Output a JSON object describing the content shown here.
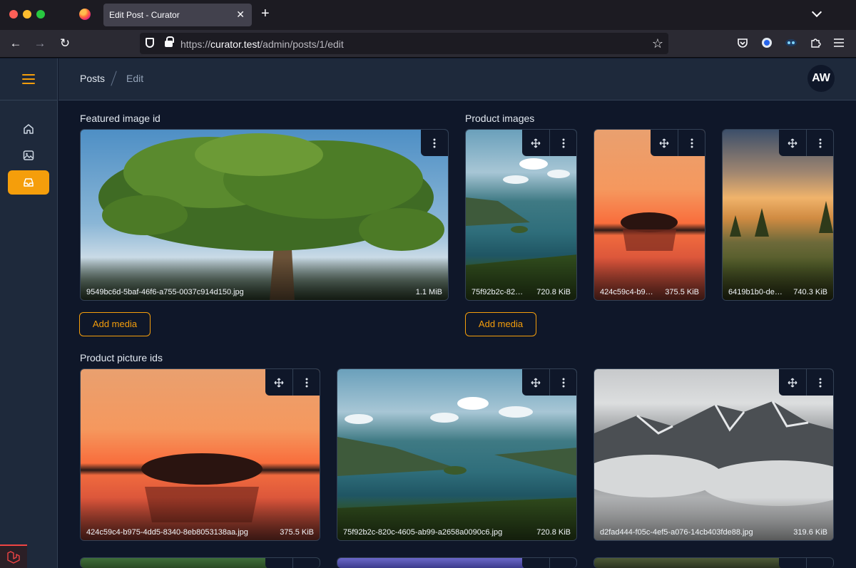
{
  "browser": {
    "tab_title": "Edit Post - Curator",
    "url_prefix": "https://",
    "url_host": "curator.test",
    "url_path": "/admin/posts/1/edit"
  },
  "breadcrumb": {
    "posts": "Posts",
    "edit": "Edit"
  },
  "user": {
    "initials": "AW"
  },
  "colors": {
    "accent": "#f59e0b",
    "background": "#0f1729",
    "panel": "#1e293b"
  },
  "featured": {
    "label": "Featured image id",
    "image": {
      "name": "9549bc6d-5baf-46f6-a755-0037c914d150.jpg",
      "size": "1.1 MiB",
      "scene": "tree"
    },
    "add_label": "Add media"
  },
  "product_images": {
    "label": "Product images",
    "items": [
      {
        "name": "75f92b2c-82…",
        "size": "720.8 KiB",
        "scene": "lake"
      },
      {
        "name": "424c59c4-b9…",
        "size": "375.5 KiB",
        "scene": "sunset"
      },
      {
        "name": "6419b1b0-de…",
        "size": "740.3 KiB",
        "scene": "field"
      }
    ],
    "add_label": "Add media"
  },
  "product_pictures": {
    "label": "Product picture ids",
    "items": [
      {
        "name": "424c59c4-b975-4dd5-8340-8eb8053138aa.jpg",
        "size": "375.5 KiB",
        "scene": "sunset"
      },
      {
        "name": "75f92b2c-820c-4605-ab99-a2658a0090c6.jpg",
        "size": "720.8 KiB",
        "scene": "lake"
      },
      {
        "name": "d2fad444-f05c-4ef5-a076-14cb403fde88.jpg",
        "size": "319.6 KiB",
        "scene": "mountain"
      }
    ]
  }
}
